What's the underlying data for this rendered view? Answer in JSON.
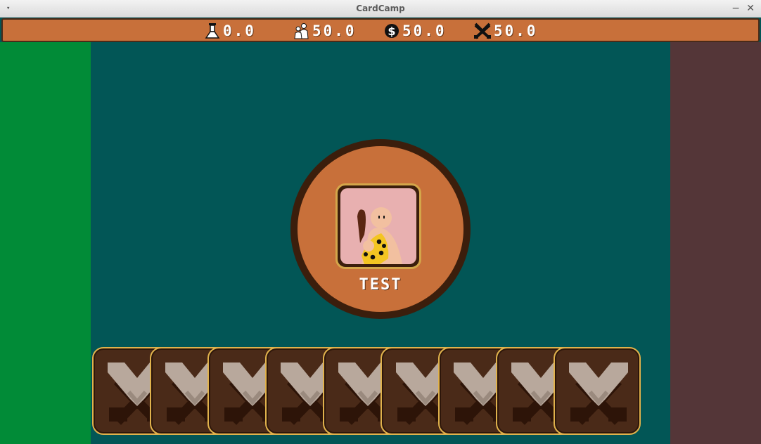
{
  "window": {
    "title": "CardCamp",
    "menu_icon": "▾",
    "minimize_icon": "−",
    "close_icon": "✕"
  },
  "resources": [
    {
      "name": "science",
      "icon": "flask-icon",
      "value": "0.0"
    },
    {
      "name": "population",
      "icon": "people-icon",
      "value": "50.0"
    },
    {
      "name": "money",
      "icon": "dollar-icon",
      "value": "50.0"
    },
    {
      "name": "military",
      "icon": "crossed-swords-icon",
      "value": "50.0"
    }
  ],
  "unit": {
    "name": "TEST",
    "portrait_icon": "caveman-icon"
  },
  "hand": {
    "card_icon": "crossed-swords-icon",
    "count": 9
  },
  "colors": {
    "resource_bar": "#c8703a",
    "board": "#025656",
    "left_panel": "#018b37",
    "right_panel": "#543638",
    "card_fill": "#4a2a18",
    "card_border": "#e0b24c",
    "medallion": "#c8703a"
  }
}
